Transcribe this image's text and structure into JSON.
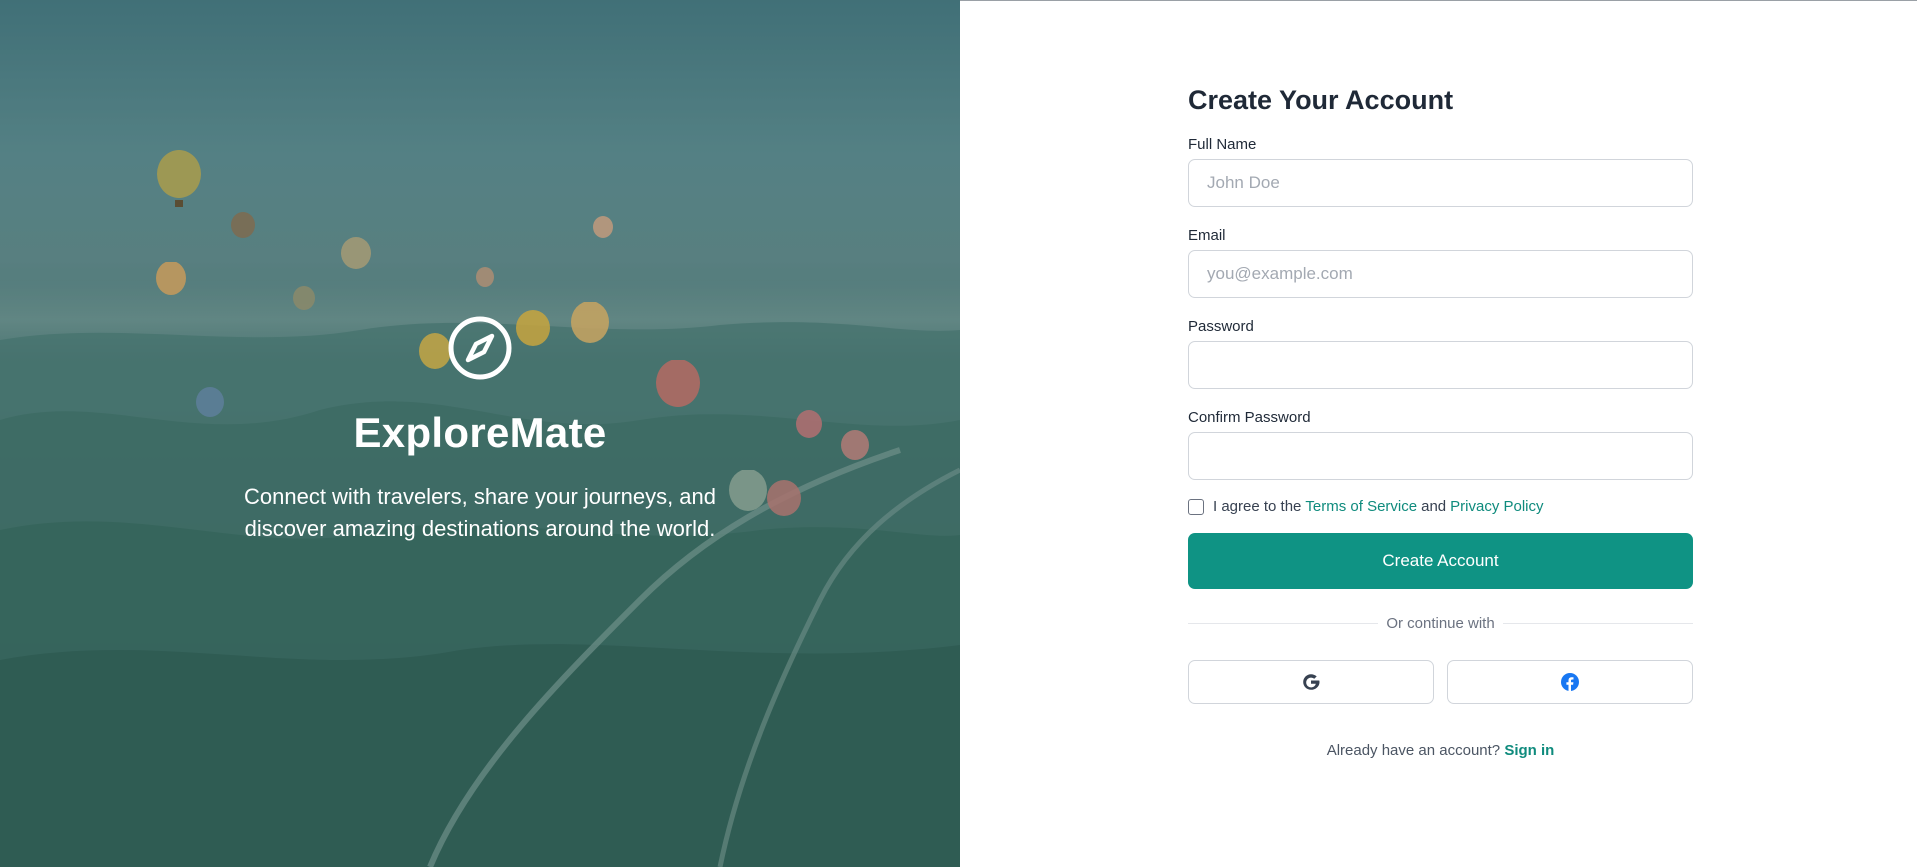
{
  "hero": {
    "brand": "ExploreMate",
    "tagline": "Connect with travelers, share your journeys, and discover amazing destinations around the world."
  },
  "form": {
    "title": "Create Your Account",
    "full_name": {
      "label": "Full Name",
      "placeholder": "John Doe",
      "value": ""
    },
    "email": {
      "label": "Email",
      "placeholder": "you@example.com",
      "value": ""
    },
    "password": {
      "label": "Password",
      "placeholder": "",
      "value": ""
    },
    "confirm_password": {
      "label": "Confirm Password",
      "placeholder": "",
      "value": ""
    },
    "agree": {
      "prefix": "I agree to the",
      "terms": "Terms of Service",
      "conjunction": "and",
      "privacy": "Privacy Policy",
      "checked": false
    },
    "submit_label": "Create Account",
    "divider_text": "Or continue with",
    "social": [
      {
        "provider": "google",
        "icon": "google-icon"
      },
      {
        "provider": "facebook",
        "icon": "facebook-icon"
      }
    ],
    "signin_prompt": "Already have an account?",
    "signin_link": "Sign in"
  },
  "colors": {
    "accent": "#0f9384",
    "link": "#0f8b7d",
    "heading": "#1f2937"
  }
}
